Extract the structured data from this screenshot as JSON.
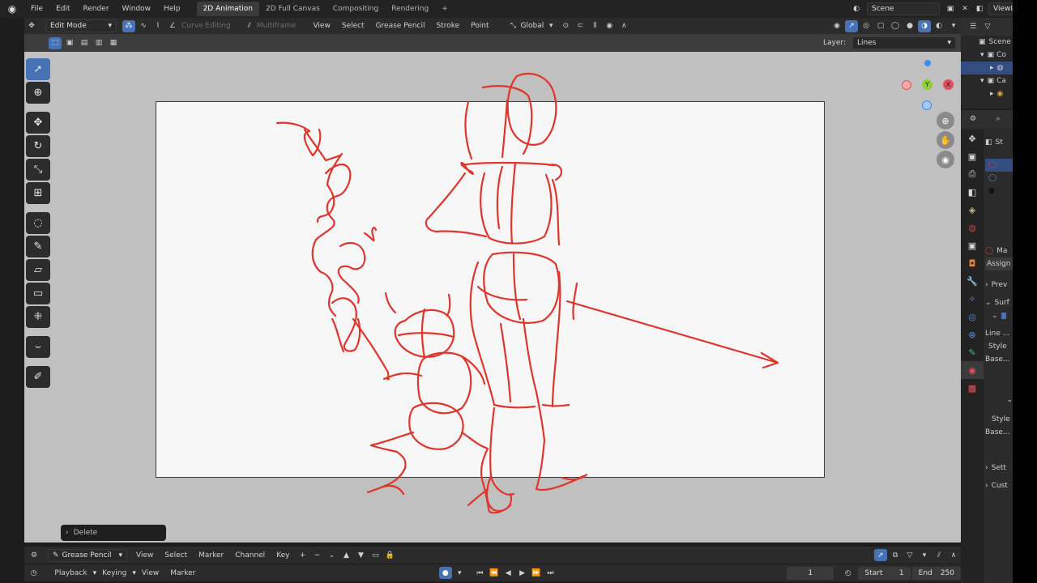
{
  "topbar": {
    "menus": [
      "File",
      "Edit",
      "Render",
      "Window",
      "Help"
    ],
    "workspaces": [
      "2D Animation",
      "2D Full Canvas",
      "Compositing",
      "Rendering"
    ],
    "add_tab": "+",
    "scene": "Scene",
    "view_layer": "ViewLayer"
  },
  "header": {
    "mode": "Edit Mode",
    "curve_editing": "Curve Editing",
    "multiframe": "Multiframe",
    "menus": [
      "View",
      "Select",
      "Grease Pencil",
      "Stroke",
      "Point"
    ],
    "orientation": "Global"
  },
  "header2": {
    "layer_label": "Layer:",
    "layer_value": "Lines"
  },
  "tools": [
    "select-box",
    "cursor",
    "move",
    "rotate",
    "scale",
    "transform",
    "radius",
    "shear",
    "bend",
    "push",
    "to-sphere",
    "extrude",
    "annotate"
  ],
  "operator_panel": {
    "label": "Delete"
  },
  "gizmo": {
    "x": "X",
    "y": "Y",
    "z": "Z"
  },
  "timeline": {
    "editor": "Grease Pencil",
    "menus": [
      "View",
      "Select",
      "Marker",
      "Channel",
      "Key"
    ],
    "playback_menus": [
      "Playback",
      "Keying",
      "View",
      "Marker"
    ],
    "current_frame": "1",
    "start_label": "Start",
    "start": "1",
    "end_label": "End",
    "end": "250"
  },
  "outliner": {
    "items": [
      "Scene",
      "Co",
      "Ca"
    ]
  },
  "properties": {
    "items": [
      "St",
      "Ma",
      "Assign",
      "Prev",
      "Surf",
      "Line ...",
      "Style",
      "Base...",
      "Style",
      "Base...",
      "Sett",
      "Cust"
    ]
  },
  "colors": {
    "accent": "#4772b3",
    "stroke": "#e0352b",
    "gizmo_x": "#e0505c",
    "gizmo_y": "#8fcf3a",
    "gizmo_z": "#3d8df0"
  }
}
